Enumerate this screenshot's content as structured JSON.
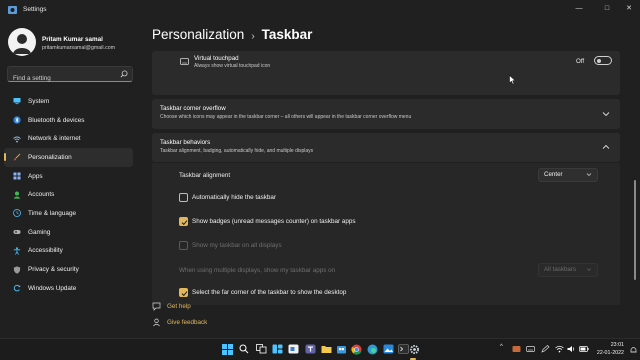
{
  "window": {
    "title": "Settings",
    "minimize": "—",
    "maximize": "□",
    "close": "✕"
  },
  "user": {
    "name": "Pritam Kumar samal",
    "email": "pritamkumarsamal@gmail.com"
  },
  "search": {
    "placeholder": "Find a setting",
    "icon": "search-icon"
  },
  "nav": [
    {
      "label": "System",
      "icon": "monitor-icon",
      "color": "#4cc2ff",
      "active": false
    },
    {
      "label": "Bluetooth & devices",
      "icon": "bluetooth-icon",
      "color": "#4cc2ff",
      "active": false
    },
    {
      "label": "Network & internet",
      "icon": "wifi-icon",
      "color": "#9fd0ff",
      "active": false
    },
    {
      "label": "Personalization",
      "icon": "brush-icon",
      "color": "#f0a040",
      "active": true
    },
    {
      "label": "Apps",
      "icon": "apps-icon",
      "color": "#8ab4f8",
      "active": false
    },
    {
      "label": "Accounts",
      "icon": "person-icon",
      "color": "#3fb950",
      "active": false
    },
    {
      "label": "Time & language",
      "icon": "clock-globe-icon",
      "color": "#4cc2ff",
      "active": false
    },
    {
      "label": "Gaming",
      "icon": "controller-icon",
      "color": "#b0b0b0",
      "active": false
    },
    {
      "label": "Accessibility",
      "icon": "accessibility-icon",
      "color": "#4cc2ff",
      "active": false
    },
    {
      "label": "Privacy & security",
      "icon": "shield-icon",
      "color": "#9a9a9a",
      "active": false
    },
    {
      "label": "Windows Update",
      "icon": "update-icon",
      "color": "#4cc2ff",
      "active": false
    }
  ],
  "breadcrumb": {
    "parent": "Personalization",
    "separator": "›",
    "current": "Taskbar"
  },
  "touchpad": {
    "title": "Virtual touchpad",
    "subtitle": "Always show virtual touchpad icon",
    "state_label": "Off",
    "on": false
  },
  "corner_overflow": {
    "title": "Taskbar corner overflow",
    "subtitle": "Choose which icons may appear in the taskbar corner – all others will appear in the taskbar corner overflow menu",
    "expanded": false
  },
  "behaviors": {
    "title": "Taskbar behaviors",
    "subtitle": "Taskbar alignment, badging, automatically hide, and multiple displays",
    "expanded": true,
    "alignment_label": "Taskbar alignment",
    "alignment_value": "Center",
    "options": [
      {
        "label": "Automatically hide the taskbar",
        "checked": false,
        "disabled": false
      },
      {
        "label": "Show badges (unread messages counter) on taskbar apps",
        "checked": true,
        "disabled": false
      },
      {
        "label": "Show my taskbar on all displays",
        "checked": false,
        "disabled": true
      }
    ],
    "multi_display_label": "When using multiple displays, show my taskbar apps on",
    "multi_display_value": "All taskbars",
    "far_corner": {
      "label": "Select the far corner of the taskbar to show the desktop",
      "checked": true
    }
  },
  "help": {
    "get_help": "Get help",
    "give_feedback": "Give feedback"
  },
  "taskbar": {
    "tray_chevron": "^",
    "clock_time": "23:01",
    "clock_date": "22-01-2022"
  },
  "colors": {
    "accent": "#e3b85c",
    "background": "#202020",
    "card": "#2b2b2b"
  }
}
